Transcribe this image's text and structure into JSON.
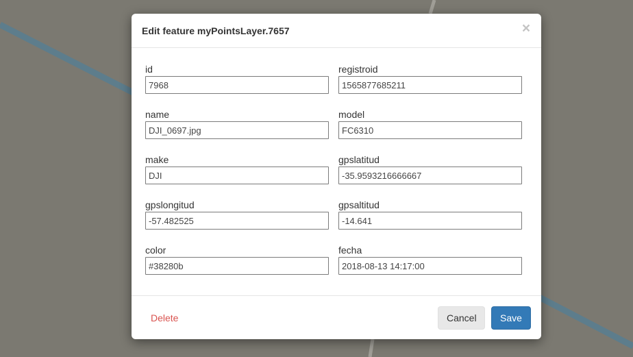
{
  "colors": {
    "map_background": "#7b7971",
    "road_blue": "#5d7d8c",
    "road_light": "#9a9891",
    "delete_red": "#d9534f",
    "save_blue": "#337ab7"
  },
  "dialog": {
    "title": "Edit feature myPointsLayer.7657",
    "close_glyph": "×",
    "fields": [
      {
        "label": "id",
        "value": "7968"
      },
      {
        "label": "registroid",
        "value": "1565877685211"
      },
      {
        "label": "name",
        "value": "DJI_0697.jpg"
      },
      {
        "label": "model",
        "value": "FC6310"
      },
      {
        "label": "make",
        "value": "DJI"
      },
      {
        "label": "gpslatitud",
        "value": "-35.9593216666667"
      },
      {
        "label": "gpslongitud",
        "value": "-57.482525"
      },
      {
        "label": "gpsaltitud",
        "value": "-14.641"
      },
      {
        "label": "color",
        "value": "#38280b"
      },
      {
        "label": "fecha",
        "value": "2018-08-13 14:17:00"
      }
    ],
    "footer": {
      "delete_label": "Delete",
      "cancel_label": "Cancel",
      "save_label": "Save"
    }
  }
}
